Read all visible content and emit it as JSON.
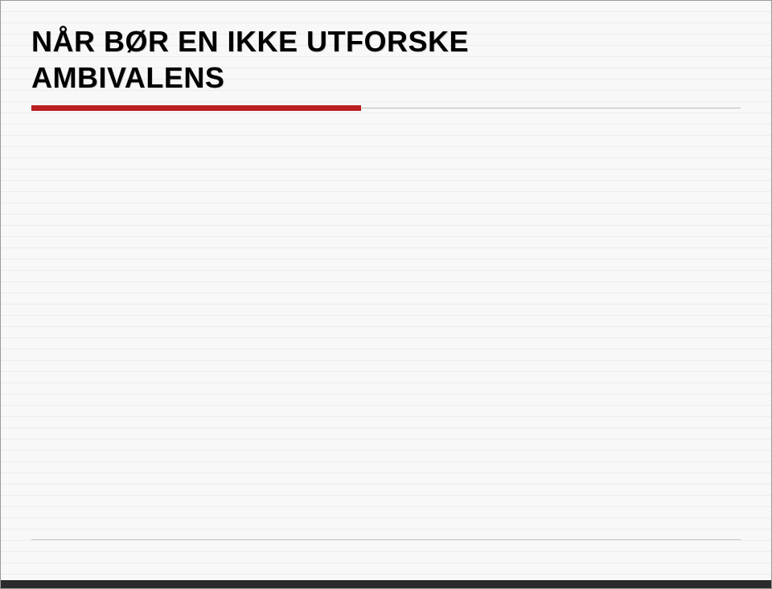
{
  "slide": {
    "title_line1": "NÅR BØR EN IKKE UTFORSKE",
    "title_line2": "AMBIVALENS"
  }
}
